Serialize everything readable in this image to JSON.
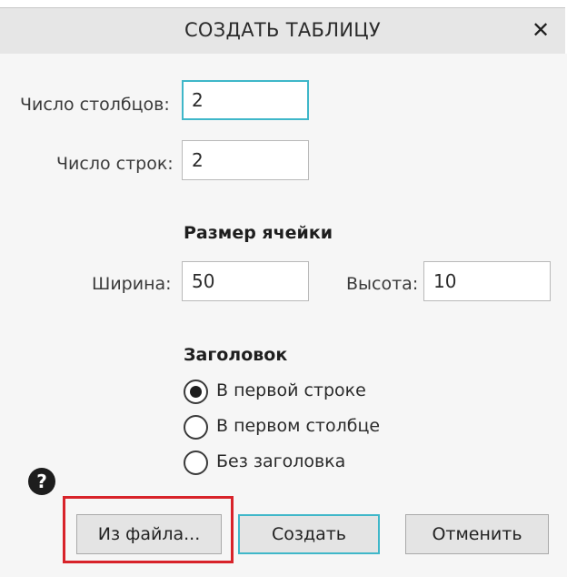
{
  "window": {
    "title": "СОЗДАТЬ ТАБЛИЦУ",
    "close_glyph": "✕"
  },
  "fields": {
    "columns_label": "Число столбцов:",
    "columns_value": "2",
    "rows_label": "Число строк:",
    "rows_value": "2"
  },
  "cell_size": {
    "heading": "Размер ячейки",
    "width_label": "Ширина:",
    "width_value": "50",
    "height_label": "Высота:",
    "height_value": "10"
  },
  "header": {
    "heading": "Заголовок",
    "options": [
      {
        "label": "В первой строке",
        "selected": true
      },
      {
        "label": "В первом столбце",
        "selected": false
      },
      {
        "label": "Без заголовка",
        "selected": false
      }
    ]
  },
  "buttons": {
    "help_glyph": "?",
    "from_file": "Из файла...",
    "create": "Создать",
    "cancel": "Отменить"
  },
  "colors": {
    "focus_accent": "#3fb7c9",
    "annotation_red": "#d8232a"
  }
}
